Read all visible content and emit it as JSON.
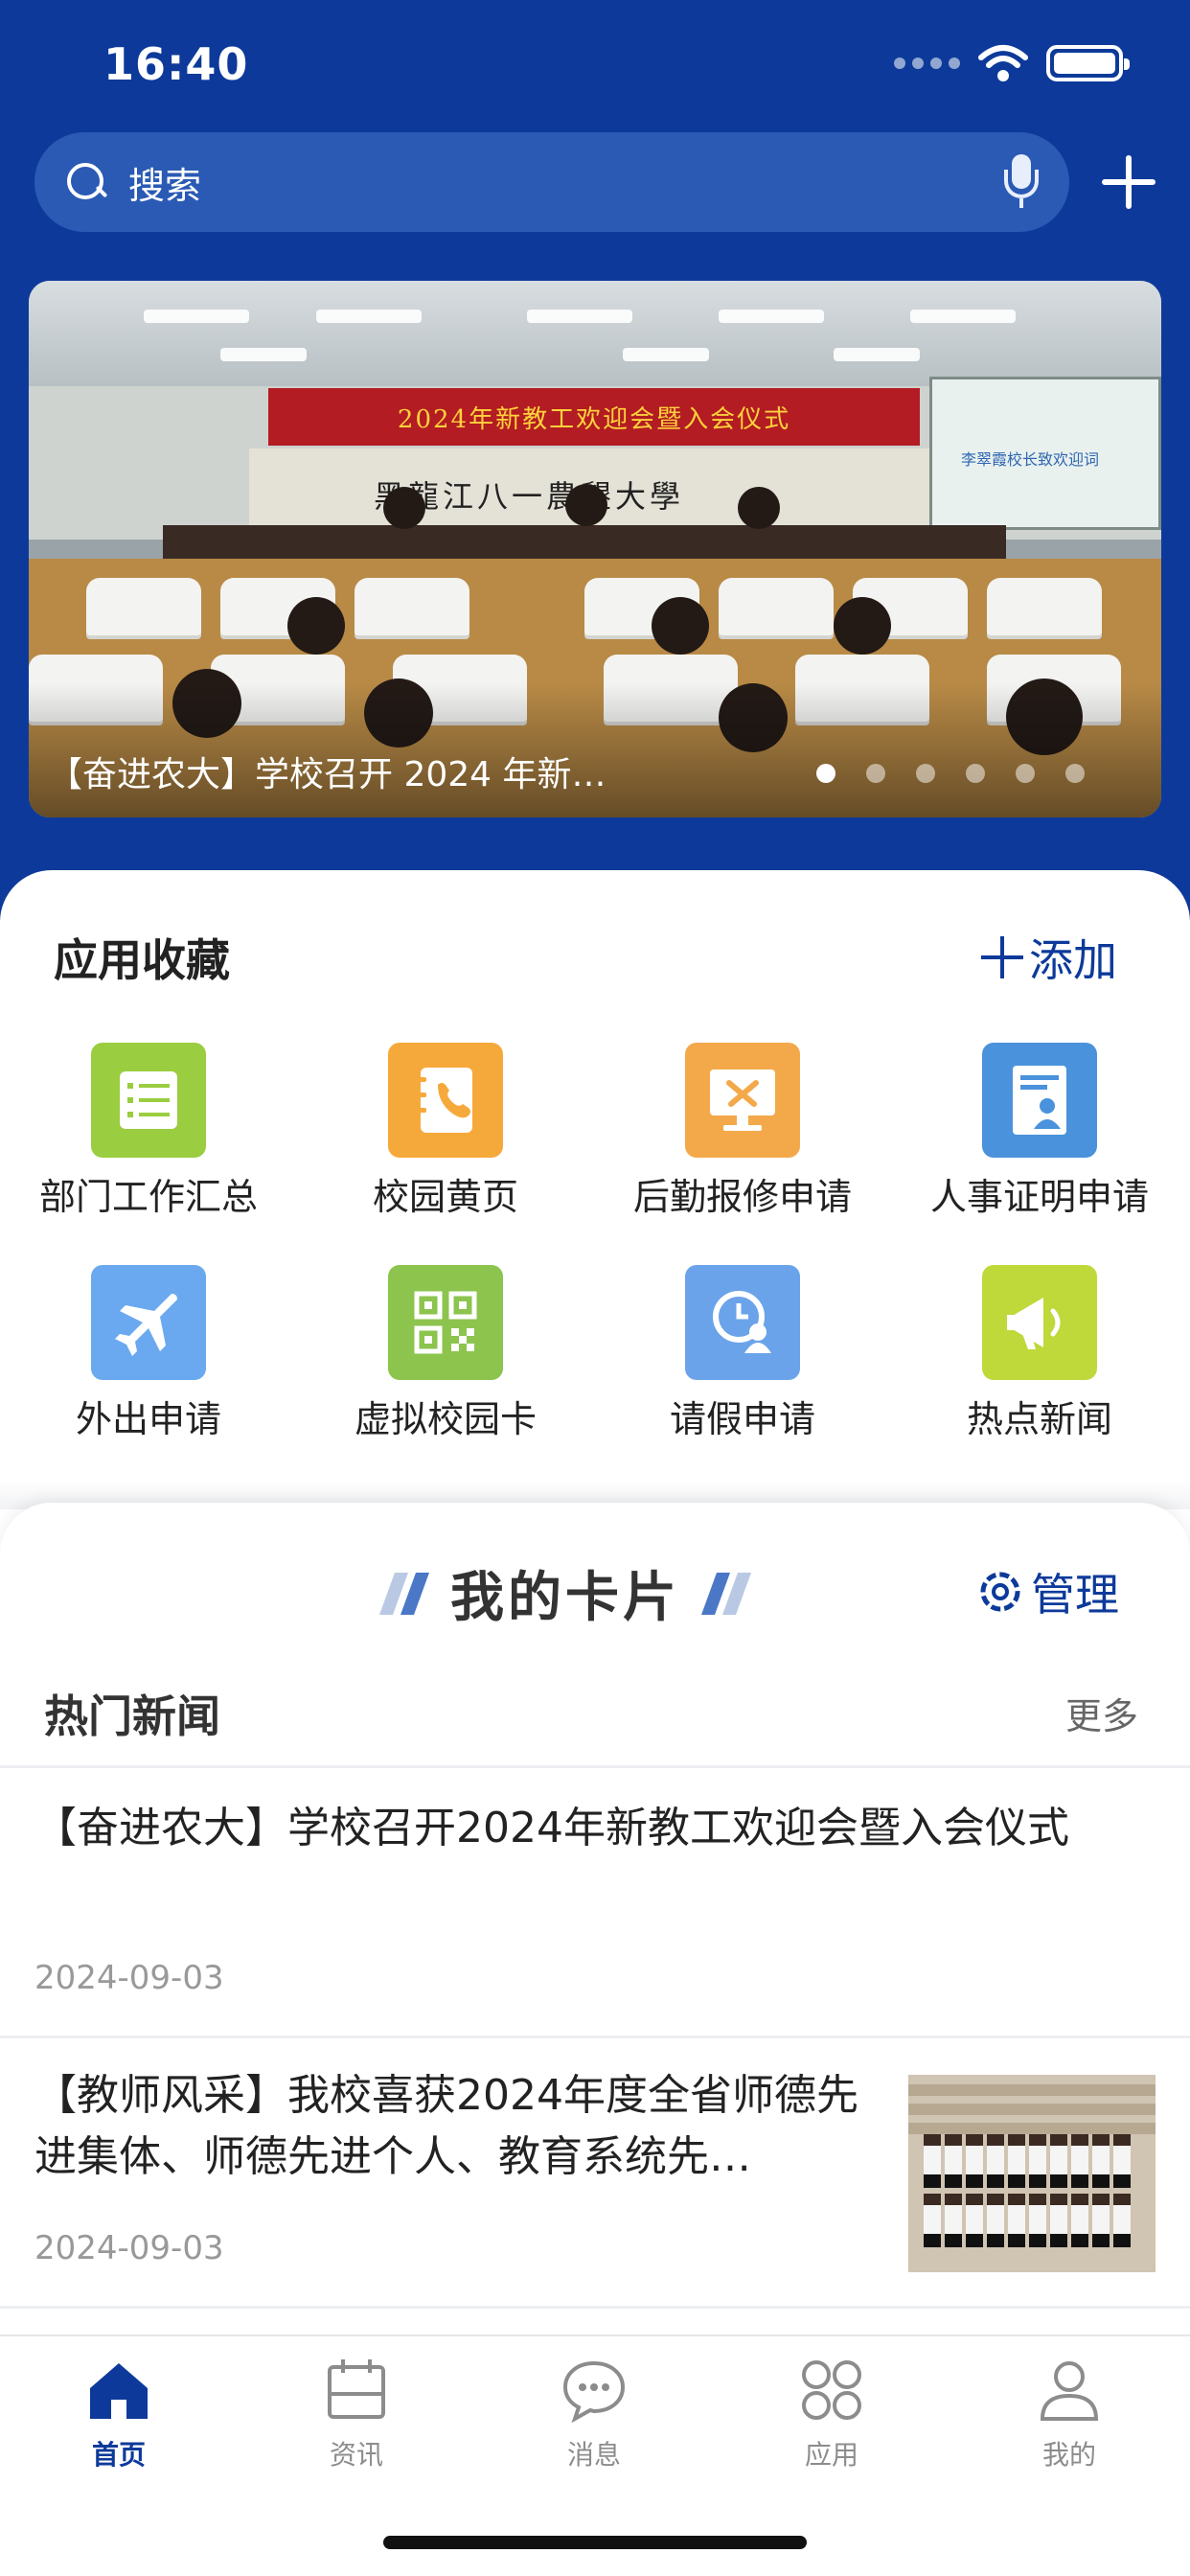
{
  "status_bar": {
    "time": "16:40"
  },
  "search": {
    "placeholder": "搜索"
  },
  "banner": {
    "slide_red_banner": "2024年新教工欢迎会暨入会仪式",
    "slide_university_name": "黑龍江八一農墾大學",
    "slide_screen_text": "李翠霞校长致欢迎词",
    "caption": "【奋进农大】学校召开 2024 年新…",
    "active_dot": 1,
    "dot_count": 6
  },
  "favorites": {
    "title": "应用收藏",
    "add_label": "添加",
    "apps": [
      {
        "label": "部门工作汇总",
        "icon": "list-icon",
        "color": "#9acd3f"
      },
      {
        "label": "校园黄页",
        "icon": "phone-book-icon",
        "color": "#f6a93b"
      },
      {
        "label": "后勤报修申请",
        "icon": "repair-monitor-icon",
        "color": "#f3a94a"
      },
      {
        "label": "人事证明申请",
        "icon": "certificate-icon",
        "color": "#4a92dc"
      },
      {
        "label": "外出申请",
        "icon": "airplane-icon",
        "color": "#6aa9ef"
      },
      {
        "label": "虚拟校园卡",
        "icon": "qr-code-icon",
        "color": "#8cc44e"
      },
      {
        "label": "请假申请",
        "icon": "leave-clock-icon",
        "color": "#6aa3ea"
      },
      {
        "label": "热点新闻",
        "icon": "megaphone-icon",
        "color": "#bfd83a"
      }
    ]
  },
  "my_cards": {
    "title": "我的卡片",
    "manage_label": "管理"
  },
  "hot_news": {
    "title": "热门新闻",
    "more_label": "更多",
    "items": [
      {
        "title": "【奋进农大】学校召开2024年新教工欢迎会暨入会仪式",
        "date": "2024-09-03"
      },
      {
        "title": "【教师风采】我校喜获2024年度全省师德先进集体、师德先进个人、教育系统先…",
        "date": "2024-09-03"
      }
    ]
  },
  "tabbar": {
    "tabs": [
      {
        "label": "首页",
        "icon": "home-icon",
        "active": true
      },
      {
        "label": "资讯",
        "icon": "calendar-icon",
        "active": false
      },
      {
        "label": "消息",
        "icon": "chat-bubble-icon",
        "active": false
      },
      {
        "label": "应用",
        "icon": "apps-grid-icon",
        "active": false
      },
      {
        "label": "我的",
        "icon": "user-icon",
        "active": false
      }
    ]
  },
  "colors": {
    "brand_blue": "#0d3a9a",
    "search_bg": "#2a5ab4"
  }
}
